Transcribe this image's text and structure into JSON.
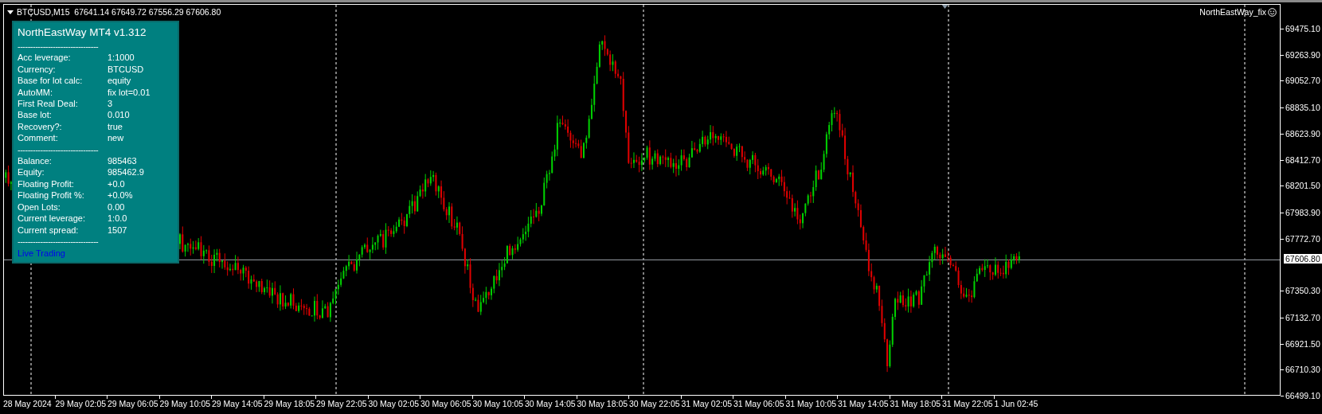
{
  "chart": {
    "symbol_info": "BTCUSD,M15  67641.14 67649.72 67556.29 67606.80",
    "indicator_label": "NorthEastWay_fix",
    "y_axis_labels": [
      "69475.10",
      "69263.90",
      "69052.70",
      "68835.10",
      "68623.90",
      "68412.70",
      "68201.50",
      "67983.90",
      "67772.70",
      "67350.30",
      "67132.70",
      "66921.50",
      "66710.30",
      "66499.10"
    ],
    "current_price": "67606.80",
    "x_axis_labels": [
      "28 May 2024",
      "29 May 02:05",
      "29 May 06:05",
      "29 May 10:05",
      "29 May 14:05",
      "29 May 18:05",
      "29 May 22:05",
      "30 May 02:05",
      "30 May 06:05",
      "30 May 10:05",
      "30 May 14:05",
      "30 May 18:05",
      "30 May 22:05",
      "31 May 02:05",
      "31 May 06:05",
      "31 May 10:05",
      "31 May 14:05",
      "31 May 18:05",
      "31 May 22:05",
      "1 Jun 02:45"
    ]
  },
  "info_panel": {
    "title": "NorthEastWay MT4 v1.312",
    "rows": [
      {
        "kind": "divider",
        "text": "--------------------------------"
      },
      {
        "kind": "pair",
        "label": "Acc leverage:",
        "value": "1:1000"
      },
      {
        "kind": "pair",
        "label": "Currency:",
        "value": "BTCUSD"
      },
      {
        "kind": "pair",
        "label": "Base for lot calc:",
        "value": "equity"
      },
      {
        "kind": "pair",
        "label": "AutoMM:",
        "value": "fix lot=0.01"
      },
      {
        "kind": "pair",
        "label": "First Real Deal:",
        "value": "3"
      },
      {
        "kind": "pair",
        "label": "Base lot:",
        "value": "0.010"
      },
      {
        "kind": "pair",
        "label": "Recovery?:",
        "value": "true"
      },
      {
        "kind": "pair",
        "label": "Comment:",
        "value": "new"
      },
      {
        "kind": "divider",
        "text": "--------------------------------"
      },
      {
        "kind": "pair",
        "label": "Balance:",
        "value": "985463"
      },
      {
        "kind": "pair",
        "label": "Equity:",
        "value": "985462.9"
      },
      {
        "kind": "pair",
        "label": "Floating Profit:",
        "value": "+0.0"
      },
      {
        "kind": "pair",
        "label": "Floating Profit %:",
        "value": "+0.0%"
      },
      {
        "kind": "pair",
        "label": "Open Lots:",
        "value": "0.00"
      },
      {
        "kind": "pair",
        "label": "Current leverage:",
        "value": "1:0.0"
      },
      {
        "kind": "pair",
        "label": "Current spread:",
        "value": "1507"
      },
      {
        "kind": "divider",
        "text": "--------------------------------"
      }
    ],
    "status": "Live Trading"
  }
}
